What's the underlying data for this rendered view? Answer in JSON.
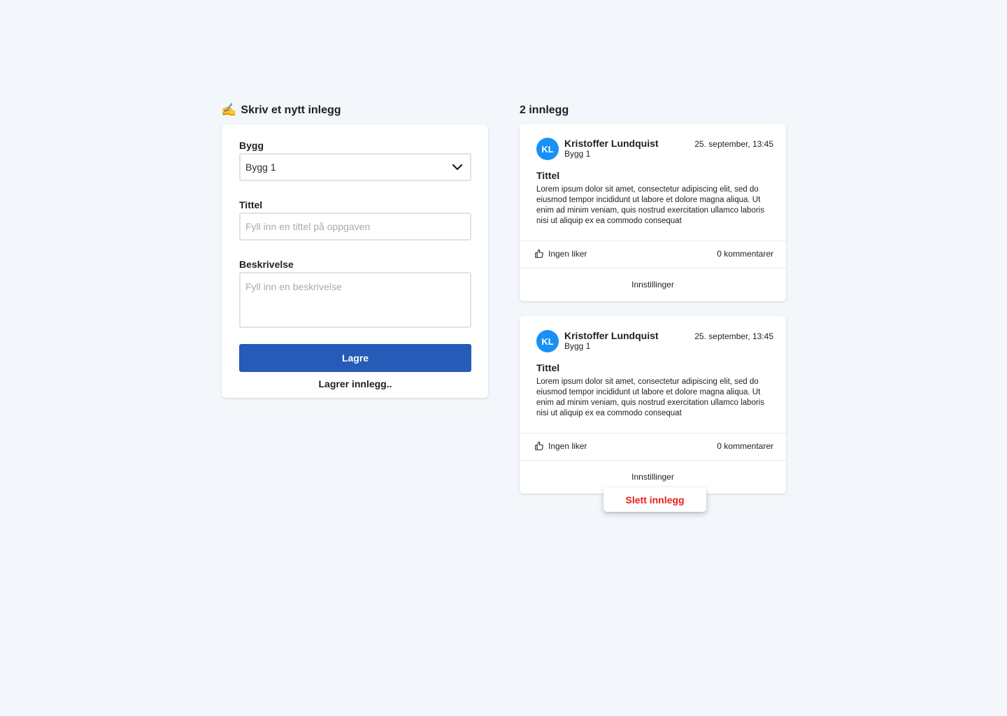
{
  "form": {
    "heading_icon": "writing-hand-icon",
    "heading_emoji": "✍️",
    "heading": "Skriv et nytt inlegg",
    "building_label": "Bygg",
    "building_value": "Bygg 1",
    "title_label": "Tittel",
    "title_placeholder": "Fyll inn en tittel på oppgaven",
    "description_label": "Beskrivelse",
    "description_placeholder": "Fyll inn en beskrivelse",
    "save_label": "Lagre",
    "saving_status": "Lagrer innlegg..",
    "accent_color": "#265bb8"
  },
  "feed": {
    "heading": "2 innlegg",
    "posts": [
      {
        "initials": "KL",
        "author": "Kristoffer Lundquist",
        "building": "Bygg 1",
        "date": "25. september, 13:45",
        "title": "Tittel",
        "body": "Lorem ipsum dolor sit amet, consectetur adipiscing elit, sed do eiusmod tempor incididunt ut labore et dolore magna aliqua. Ut enim ad minim veniam, quis nostrud exercitation ullamco laboris nisi ut aliquip ex ea commodo consequat",
        "likes": "Ingen liker",
        "comments": "0 kommentarer",
        "settings": "Innstillinger"
      },
      {
        "initials": "KL",
        "author": "Kristoffer Lundquist",
        "building": "Bygg 1",
        "date": "25. september, 13:45",
        "title": "Tittel",
        "body": "Lorem ipsum dolor sit amet, consectetur adipiscing elit, sed do eiusmod tempor incididunt ut labore et dolore magna aliqua. Ut enim ad minim veniam, quis nostrud exercitation ullamco laboris nisi ut aliquip ex ea commodo consequat",
        "likes": "Ingen liker",
        "comments": "0 kommentarer",
        "settings": "Innstillinger"
      }
    ],
    "menu": {
      "delete_label": "Slett innlegg",
      "delete_color": "#ee1c1c"
    },
    "avatar_color": "#1890f5"
  }
}
